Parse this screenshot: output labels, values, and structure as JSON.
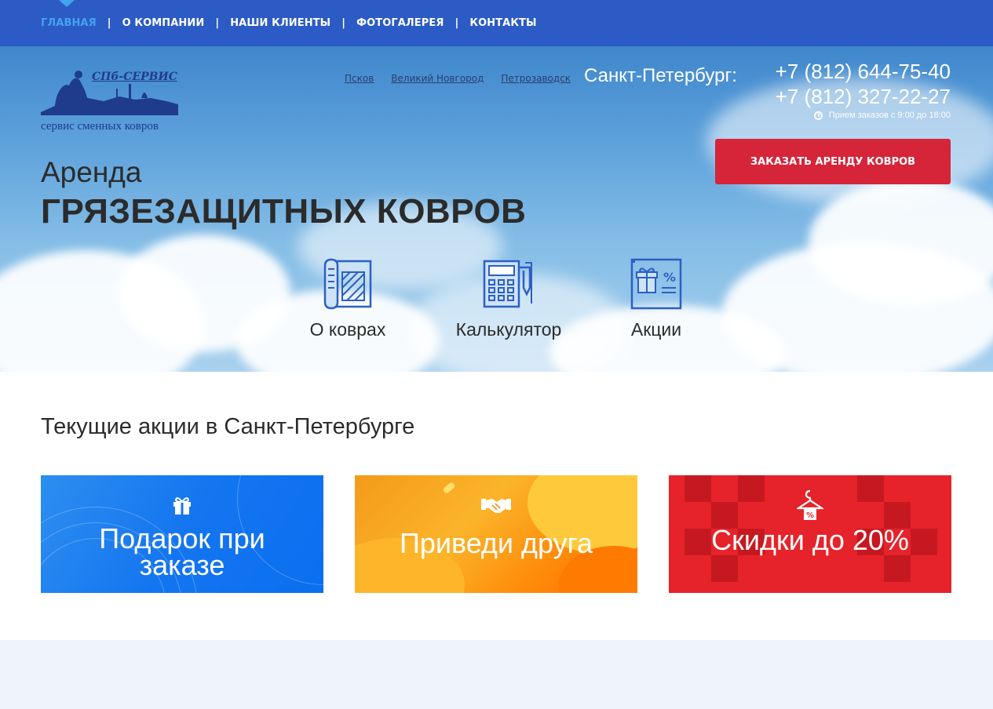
{
  "nav": {
    "items": [
      {
        "label": "ГЛАВНАЯ",
        "active": true
      },
      {
        "label": "О КОМПАНИИ",
        "active": false
      },
      {
        "label": "НАШИ КЛИЕНТЫ",
        "active": false
      },
      {
        "label": "ФОТОГАЛЕРЕЯ",
        "active": false
      },
      {
        "label": "КОНТАКТЫ",
        "active": false
      }
    ],
    "separator": "|"
  },
  "logo": {
    "brand": "СПб-СЕРВИС",
    "tagline": "сервис сменных ковров"
  },
  "cities": [
    "Псков",
    "Великий Новгород",
    "Петрозаводск"
  ],
  "current_city": "Санкт-Петербург:",
  "contacts": {
    "phones": [
      "+7 (812) 644-75-40",
      "+7 (812) 327-22-27"
    ],
    "hours": "Прием заказов с 9:00 до 18:00"
  },
  "cta": {
    "label": "ЗАКАЗАТЬ АРЕНДУ КОВРОВ"
  },
  "hero": {
    "line1": "Аренда",
    "line2": "ГРЯЗЕЗАЩИТНЫХ КОВРОВ"
  },
  "features": [
    {
      "label": "О коврах",
      "icon": "carpet-roll-icon"
    },
    {
      "label": "Калькулятор",
      "icon": "calculator-icon"
    },
    {
      "label": "Акции",
      "icon": "gift-percent-icon"
    }
  ],
  "promos": {
    "title": "Текущие акции в Санкт-Петербурге",
    "cards": [
      {
        "title": "Подарок при заказе",
        "line1": "Подарок при",
        "line2": "заказе",
        "icon": "gift-icon",
        "color": "#1475f0"
      },
      {
        "title": "Приведи друга",
        "icon": "handshake-icon",
        "color": "#fb8c12"
      },
      {
        "title": "Скидки до 20%",
        "icon": "hanger-percent-icon",
        "color": "#e6232a"
      }
    ]
  },
  "colors": {
    "nav_bg": "#2c5bc6",
    "nav_active": "#44a2ee",
    "cta_bg": "#d62439",
    "logo_blue": "#1f3b8c",
    "icon_blue": "#2d5fc4"
  }
}
